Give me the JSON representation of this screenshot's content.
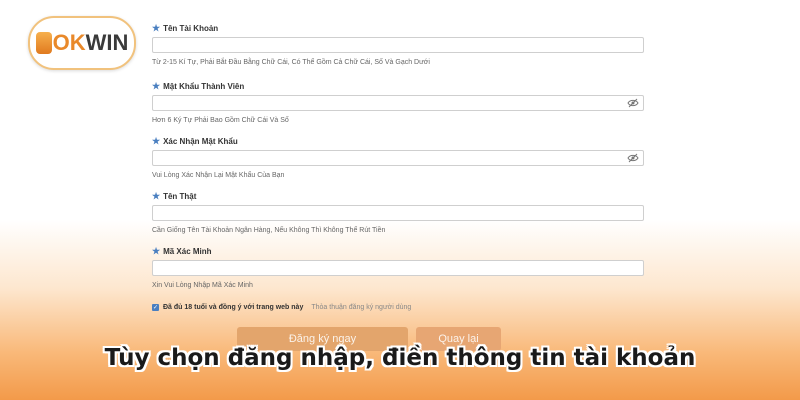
{
  "logo": {
    "part1": "OK",
    "part2": "WIN"
  },
  "form": {
    "username": {
      "label": "Tên Tài Khoản",
      "value": "",
      "hint": "Từ 2-15 Kí Tự, Phải Bắt Đầu Bằng Chữ Cái, Có Thể Gồm Cả Chữ Cái, Số Và Gạch Dưới"
    },
    "password": {
      "label": "Mật Khẩu Thành Viên",
      "value": "",
      "hint": "Hơn 6 Ký Tự Phải Bao Gồm Chữ Cái Và Số"
    },
    "confirm_password": {
      "label": "Xác Nhận Mật Khẩu",
      "value": "",
      "hint": "Vui Lòng Xác Nhận Lại Mật Khẩu Của Bạn"
    },
    "real_name": {
      "label": "Tên Thật",
      "value": "",
      "hint": "Cần Giống Tên Tài Khoản Ngân Hàng, Nếu Không Thì Không Thể Rút Tiền"
    },
    "verify_code": {
      "label": "Mã Xác Minh",
      "value": "",
      "hint": "Xin Vui Lòng Nhập Mã Xác Minh"
    }
  },
  "agreement": {
    "text": "Đã đủ 18 tuổi và đồng ý với trang web này",
    "link": "Thỏa thuận đăng ký người dùng"
  },
  "buttons": {
    "register": "Đăng ký ngay",
    "back": "Quay lại"
  },
  "caption": "Tùy chọn đăng nhập, điền thông tin tài khoản",
  "colors": {
    "accent": "#4a7fc0",
    "logo_orange": "#e9892a",
    "button_primary": "#e3a56c",
    "bottom_gradient": "#f39a4a"
  }
}
